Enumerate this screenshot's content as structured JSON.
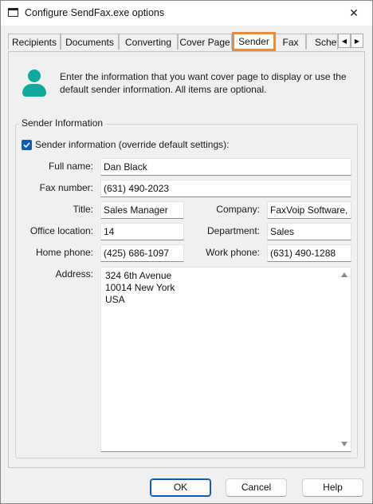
{
  "window": {
    "title": "Configure SendFax.exe options",
    "close_glyph": "✕"
  },
  "tabs": [
    {
      "label": "Recipients"
    },
    {
      "label": "Documents"
    },
    {
      "label": "Converting"
    },
    {
      "label": "Cover Page"
    },
    {
      "label": "Sender"
    },
    {
      "label": "Fax"
    },
    {
      "label": "Sche"
    }
  ],
  "tab_scroll": {
    "left": "◀",
    "right": "▶"
  },
  "info": {
    "text": "Enter the information that you want cover page to display or use the default sender information. All items are optional."
  },
  "group": {
    "label": "Sender Information",
    "checkbox_label": "Sender information (override default settings):",
    "checkbox_checked": true
  },
  "fields": {
    "full_name": {
      "label": "Full name:",
      "value": "Dan Black"
    },
    "fax_number": {
      "label": "Fax number:",
      "value": "(631) 490-2023"
    },
    "title": {
      "label": "Title:",
      "value": "Sales Manager"
    },
    "company": {
      "label": "Company:",
      "value": "FaxVoip Software, L"
    },
    "office_location": {
      "label": "Office location:",
      "value": "14"
    },
    "department": {
      "label": "Department:",
      "value": "Sales"
    },
    "home_phone": {
      "label": "Home phone:",
      "value": "(425) 686-1097"
    },
    "work_phone": {
      "label": "Work phone:",
      "value": "(631) 490-1288"
    },
    "address": {
      "label": "Address:",
      "lines": [
        "324 6th Avenue",
        "10014 New York",
        "USA"
      ]
    }
  },
  "buttons": {
    "ok": "OK",
    "cancel": "Cancel",
    "help": "Help"
  },
  "colors": {
    "accent": "#0f5cb8",
    "tab_highlight": "#f08a34",
    "avatar": "#13a89e"
  }
}
